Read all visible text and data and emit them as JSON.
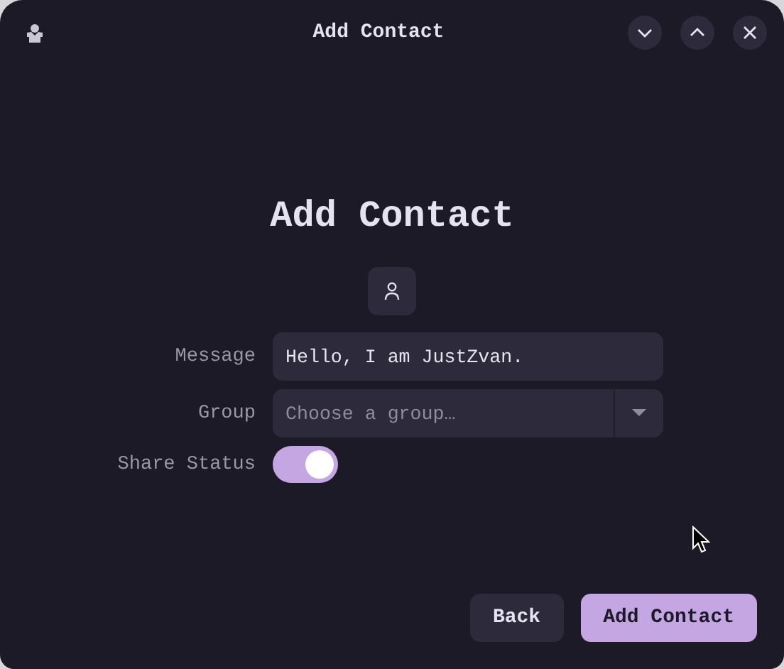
{
  "window": {
    "title": "Add Contact"
  },
  "heading": "Add Contact",
  "form": {
    "message": {
      "label": "Message",
      "value": "Hello, I am JustZvan."
    },
    "group": {
      "label": "Group",
      "placeholder": "Choose a group…"
    },
    "share_status": {
      "label": "Share Status",
      "on": true
    }
  },
  "buttons": [
    {
      "label": "Back",
      "kind": "secondary"
    },
    {
      "label": "Add Contact",
      "kind": "primary"
    }
  ]
}
